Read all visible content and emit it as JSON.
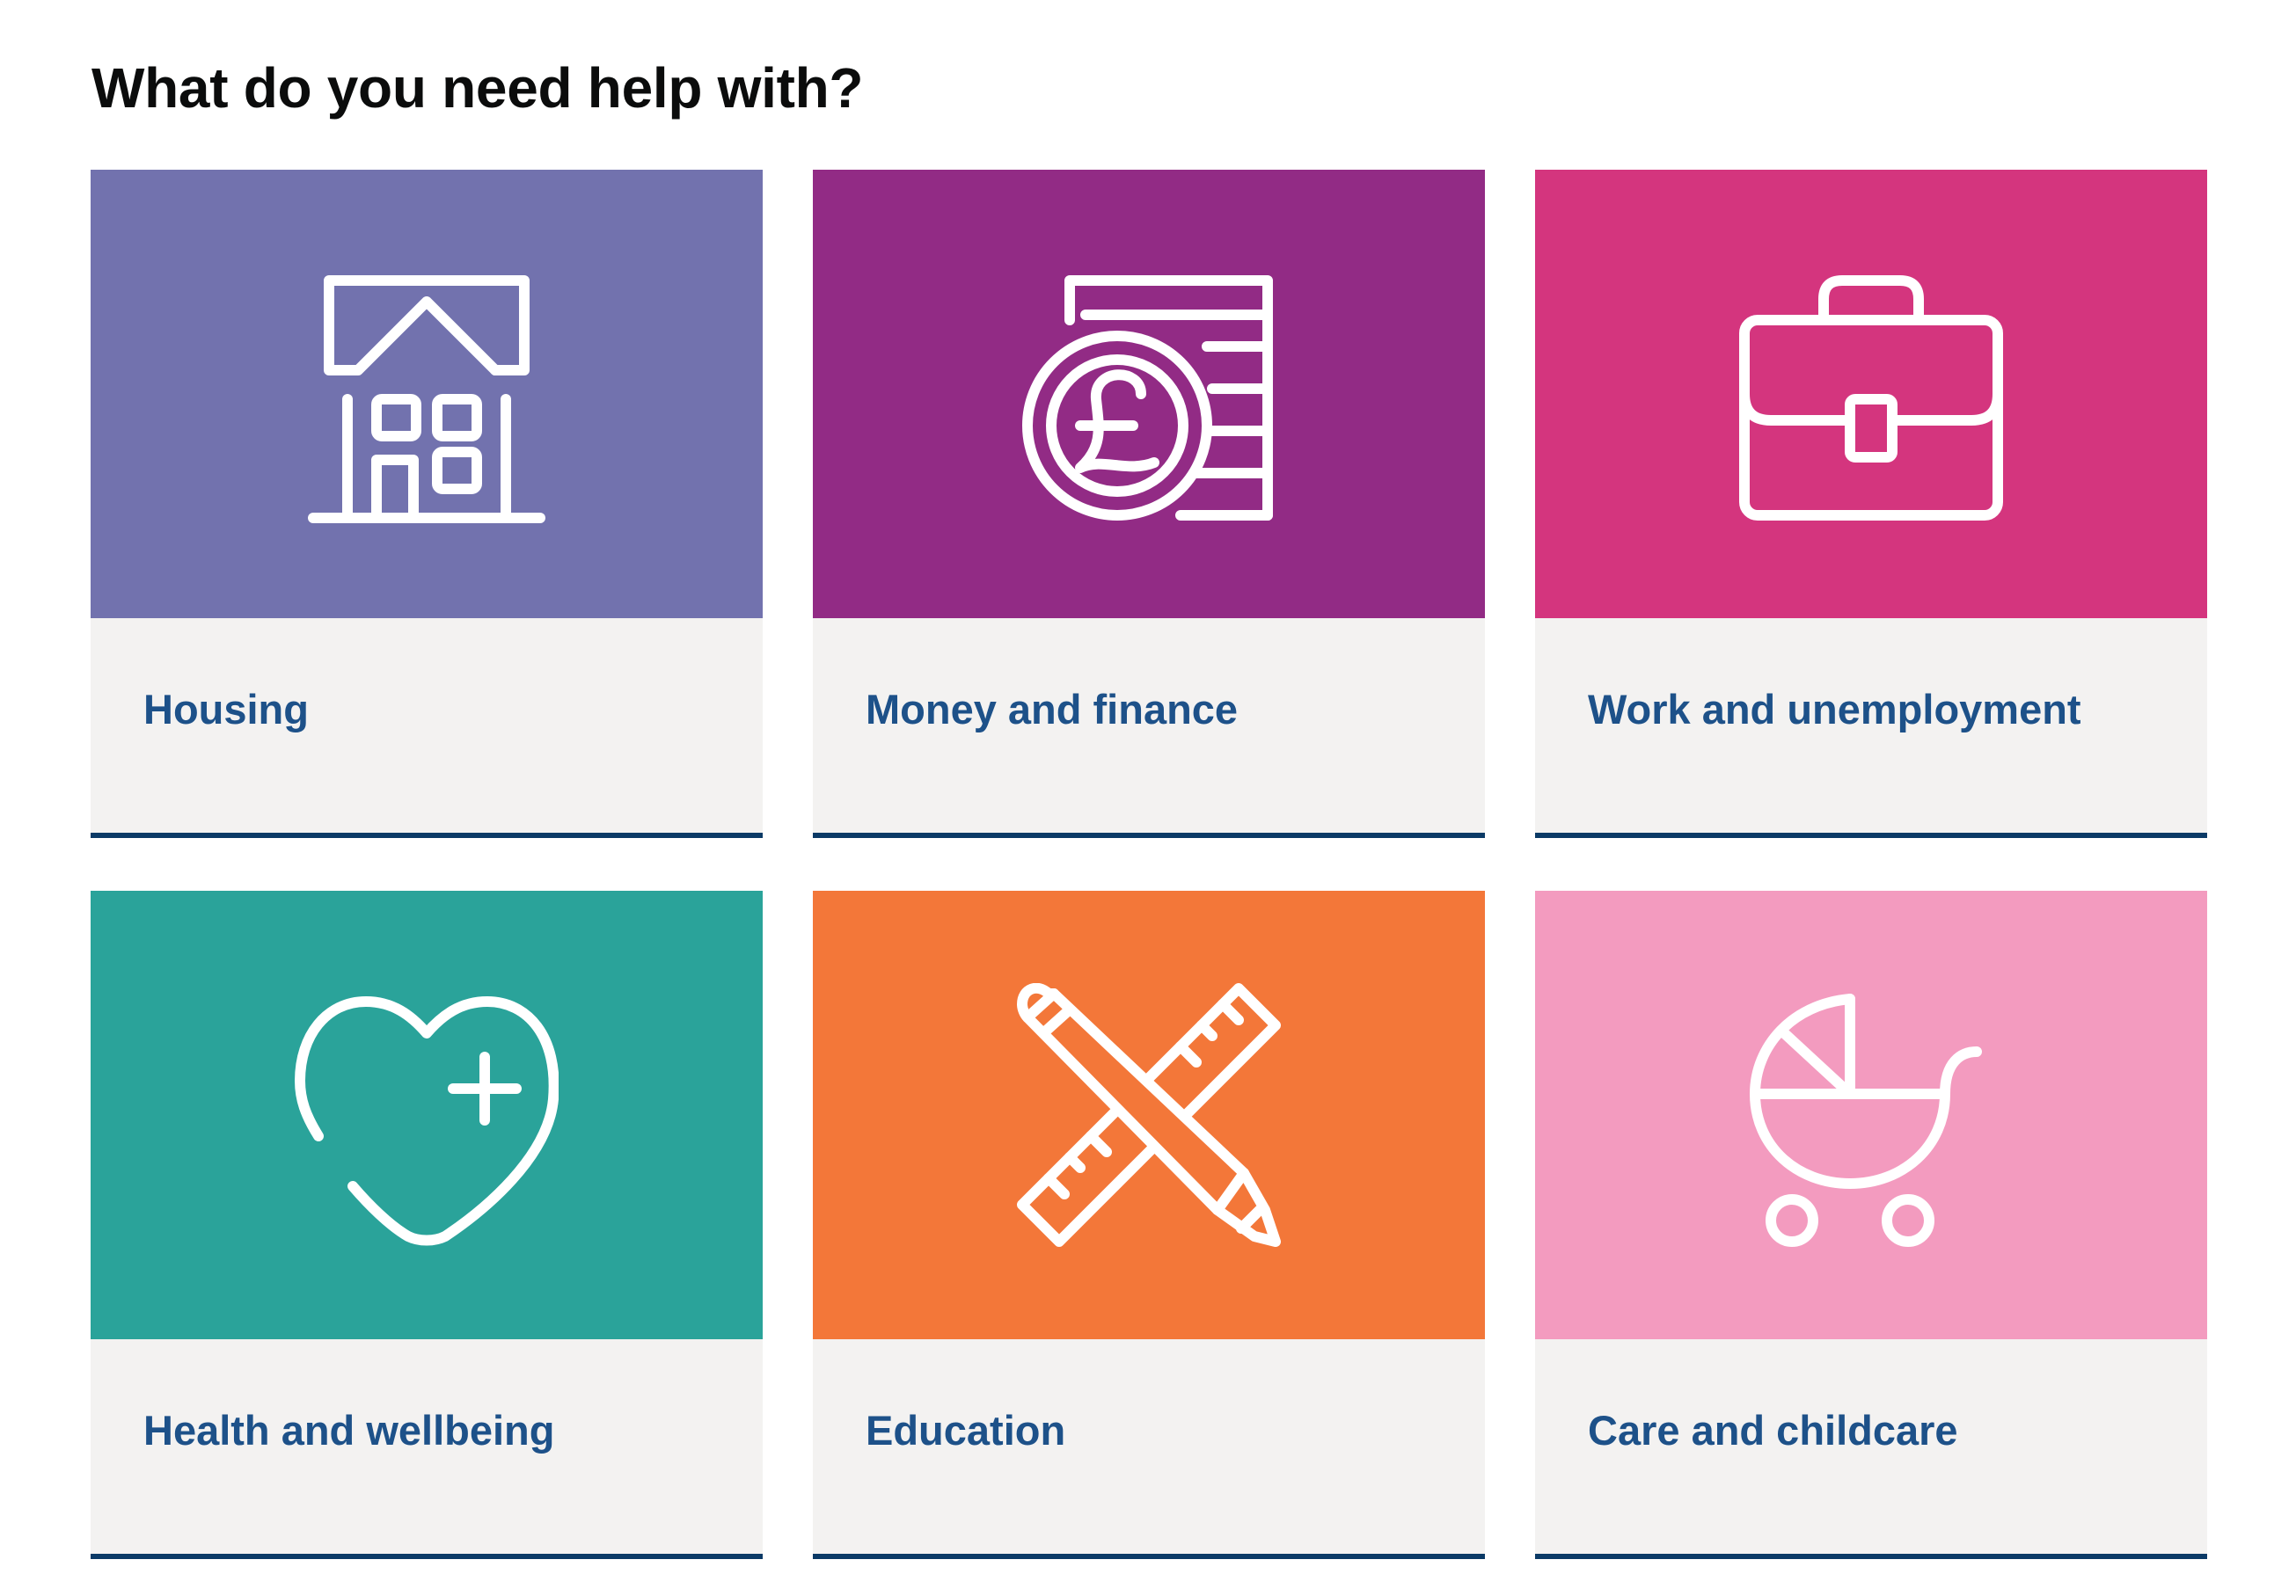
{
  "page": {
    "title": "What do you need help with?"
  },
  "cards": [
    {
      "label": "Housing",
      "icon": "house-icon",
      "color": "#7272ae"
    },
    {
      "label": "Money and finance",
      "icon": "pound-coin-icon",
      "color": "#922b85"
    },
    {
      "label": "Work and unemployment",
      "icon": "briefcase-icon",
      "color": "#d4357e"
    },
    {
      "label": "Health and wellbeing",
      "icon": "heart-plus-icon",
      "color": "#2aa39a"
    },
    {
      "label": "Education",
      "icon": "pencil-ruler-icon",
      "color": "#f37739"
    },
    {
      "label": "Care and childcare",
      "icon": "pram-icon",
      "color": "#f39bbf"
    }
  ],
  "colors": {
    "card_background": "#f3f2f1",
    "card_border": "#0b3a66",
    "label_text": "#1d5189",
    "title_text": "#0b0c0c"
  }
}
